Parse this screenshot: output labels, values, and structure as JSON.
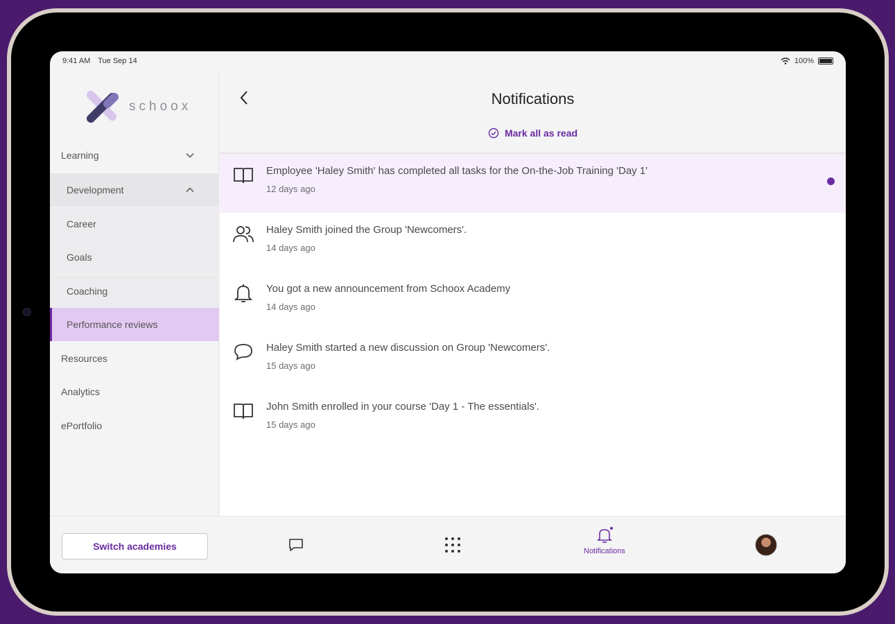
{
  "status_bar": {
    "time": "9:41 AM",
    "date": "Tue Sep 14",
    "battery": "100%"
  },
  "sidebar": {
    "logo_text": "schoox",
    "items": [
      {
        "label": "Learning"
      },
      {
        "label": "Development"
      },
      {
        "label": "Career"
      },
      {
        "label": "Goals"
      },
      {
        "label": "Coaching"
      },
      {
        "label": "Performance reviews"
      },
      {
        "label": "Resources"
      },
      {
        "label": "Analytics"
      },
      {
        "label": "ePortfolio"
      }
    ]
  },
  "header": {
    "title": "Notifications",
    "mark_all_label": "Mark all as read"
  },
  "notifications": [
    {
      "icon": "book-icon",
      "text": "Employee 'Haley Smith' has completed all tasks for the On-the-Job Training 'Day 1'",
      "time": "12 days ago",
      "unread": true
    },
    {
      "icon": "group-icon",
      "text": "Haley Smith joined the Group 'Newcomers'.",
      "time": "14 days ago",
      "unread": false
    },
    {
      "icon": "bell-icon",
      "text": "You got a new announcement from Schoox Academy",
      "time": "14 days ago",
      "unread": false
    },
    {
      "icon": "chat-bubble-icon",
      "text": "Haley Smith started a new discussion on Group 'Newcomers'.",
      "time": "15 days ago",
      "unread": false
    },
    {
      "icon": "book-icon",
      "text": "John Smith enrolled in your course 'Day 1 - The essentials'.",
      "time": "15 days ago",
      "unread": false
    }
  ],
  "bottom_bar": {
    "switch_label": "Switch academies",
    "notifications_label": "Notifications"
  },
  "colors": {
    "accent": "#6a2ba1",
    "selected_bg": "#e2c9f2",
    "unread_bg": "#f7eefc"
  }
}
